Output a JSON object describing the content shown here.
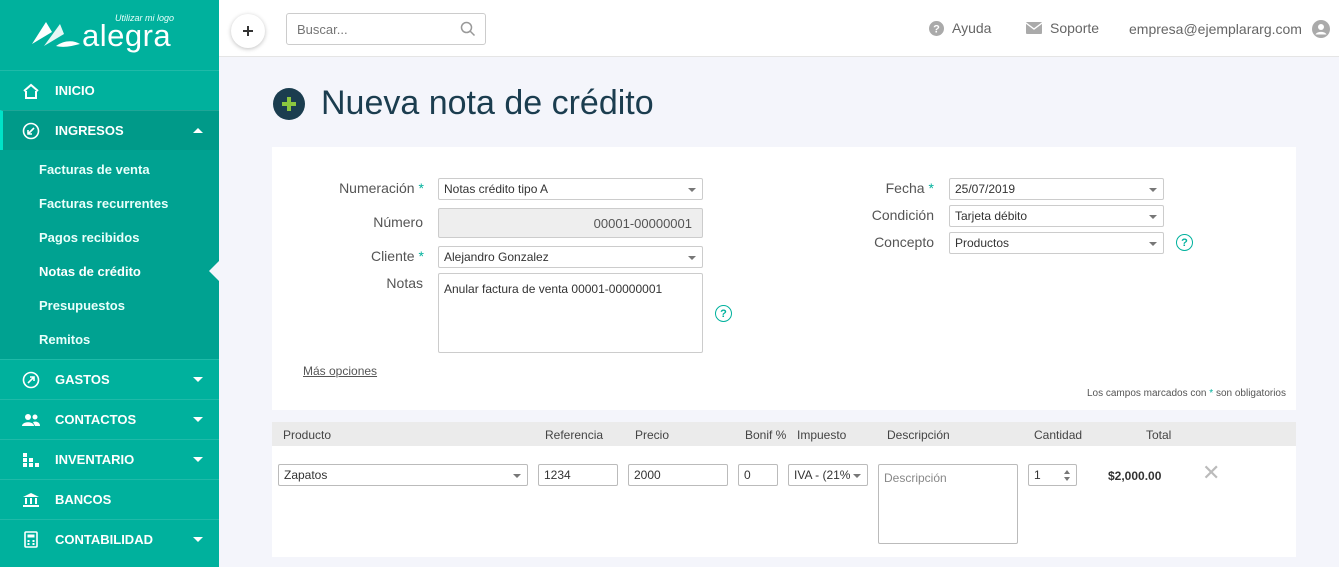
{
  "sidebar": {
    "logo_tagline": "Utilizar mi logo",
    "logo_word": "alegra",
    "items": [
      {
        "label": "INICIO"
      },
      {
        "label": "INGRESOS"
      },
      {
        "label": "GASTOS"
      },
      {
        "label": "CONTACTOS"
      },
      {
        "label": "INVENTARIO"
      },
      {
        "label": "BANCOS"
      },
      {
        "label": "CONTABILIDAD"
      }
    ],
    "submenu": [
      {
        "label": "Facturas de venta"
      },
      {
        "label": "Facturas recurrentes"
      },
      {
        "label": "Pagos recibidos"
      },
      {
        "label": "Notas de crédito"
      },
      {
        "label": "Presupuestos"
      },
      {
        "label": "Remitos"
      }
    ]
  },
  "topbar": {
    "search_placeholder": "Buscar...",
    "help_label": "Ayuda",
    "support_label": "Soporte",
    "user_email": "empresa@ejemplararg.com"
  },
  "page": {
    "title": "Nueva nota de crédito"
  },
  "form": {
    "numeracion_label": "Numeración",
    "numeracion_value": "Notas crédito tipo A",
    "numero_label": "Número",
    "numero_value": "00001-00000001",
    "cliente_label": "Cliente",
    "cliente_value": "Alejandro Gonzalez",
    "notas_label": "Notas",
    "notas_value": "Anular factura de venta 00001-00000001",
    "fecha_label": "Fecha",
    "fecha_value": "25/07/2019",
    "condicion_label": "Condición",
    "condicion_value": "Tarjeta débito",
    "concepto_label": "Concepto",
    "concepto_value": "Productos",
    "required_marker": "*",
    "more_options": "Más opciones",
    "required_note_prefix": "Los campos marcados con",
    "required_note_suffix": "son obligatorios",
    "help_glyph": "?"
  },
  "table": {
    "headers": [
      "Producto",
      "Referencia",
      "Precio",
      "Bonif %",
      "Impuesto",
      "Descripción",
      "Cantidad",
      "Total"
    ],
    "row": {
      "producto": "Zapatos",
      "referencia": "1234",
      "precio": "2000",
      "bonif": "0",
      "impuesto": "IVA - (21%",
      "descripcion_placeholder": "Descripción",
      "cantidad": "1",
      "total": "$2,000.00",
      "remove_glyph": "✕"
    }
  },
  "colors": {
    "brand": "#00b19d",
    "title": "#1b3d4f"
  }
}
